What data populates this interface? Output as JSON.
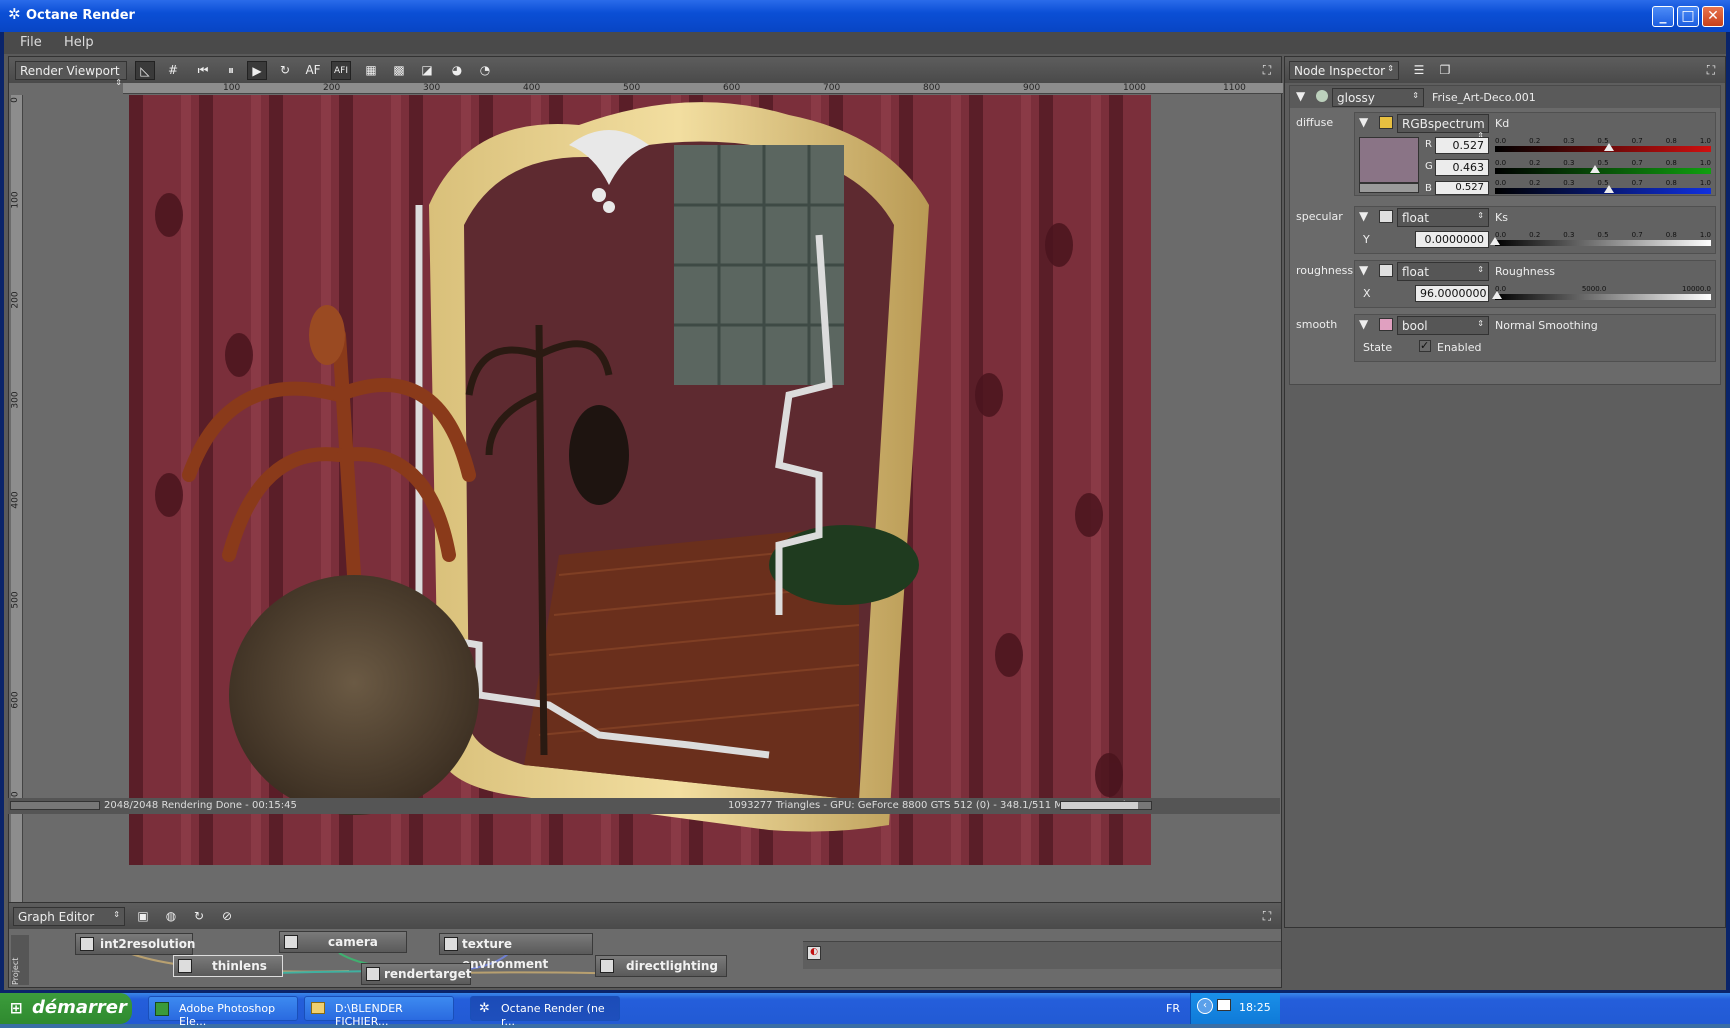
{
  "window": {
    "title": "Octane Render"
  },
  "menu": {
    "items": [
      "File",
      "Help"
    ]
  },
  "viewport_panel": {
    "combo": "Render Viewport",
    "tools": [
      "AF",
      "AFI"
    ],
    "ruler_top": [
      "100",
      "200",
      "300",
      "400",
      "500",
      "600",
      "700",
      "800",
      "900",
      "1000",
      "1100"
    ],
    "ruler_left": [
      "0",
      "100",
      "200",
      "300",
      "400",
      "500",
      "600",
      "700"
    ],
    "status_left": "2048/2048 Rendering Done - 00:15:45",
    "status_right": "1093277 Triangles - GPU: GeForce 8800 GTS 512 (0) - 348.1/511 MB Mem Used",
    "progress": 0.85
  },
  "node_inspector": {
    "combo": "Node Inspector",
    "node_type": "glossy",
    "node_name": "Frise_Art-Deco.001",
    "diffuse": {
      "label": "diffuse",
      "type": "RGBspectrum",
      "param": "Kd",
      "color": "#8a7486",
      "r_label": "R",
      "r": "0.527",
      "g_label": "G",
      "g": "0.463",
      "b_label": "B",
      "b": "0.527",
      "scale": [
        "0.0",
        "0.2",
        "0.3",
        "0.5",
        "0.7",
        "0.8",
        "1.0"
      ]
    },
    "specular": {
      "label": "specular",
      "type": "float",
      "param": "Ks",
      "axis": "Y",
      "value": "0.0000000",
      "scale": [
        "0.0",
        "0.2",
        "0.3",
        "0.5",
        "0.7",
        "0.8",
        "1.0"
      ]
    },
    "roughness": {
      "label": "roughness",
      "type": "float",
      "param": "Roughness",
      "axis": "X",
      "value": "96.0000000",
      "scale": [
        "0.0",
        "5000.0",
        "10000.0"
      ]
    },
    "smooth": {
      "label": "smooth",
      "type": "bool",
      "param": "Normal Smoothing",
      "state_label": "State",
      "enabled_label": "Enabled",
      "checked": true
    }
  },
  "graph_editor": {
    "combo": "Graph Editor",
    "side_tab": "Project",
    "nodes": [
      {
        "label": "int2resolution"
      },
      {
        "label": "camera"
      },
      {
        "label": "texture environment"
      },
      {
        "label": "thinlens"
      },
      {
        "label": "rendertarget"
      },
      {
        "label": "directlighting"
      }
    ]
  },
  "taskbar": {
    "start": "démarrer",
    "tasks": [
      "Adobe Photoshop Ele...",
      "D:\\BLENDER FICHIER...",
      "Octane Render (ne r..."
    ],
    "lang": "FR",
    "time": "18:25"
  },
  "colors": {
    "accent_red": "#d01010",
    "accent_green": "#10a010",
    "accent_blue": "#1030e0",
    "xp_blue": "#245edb",
    "wall": "#7b2f3b"
  }
}
